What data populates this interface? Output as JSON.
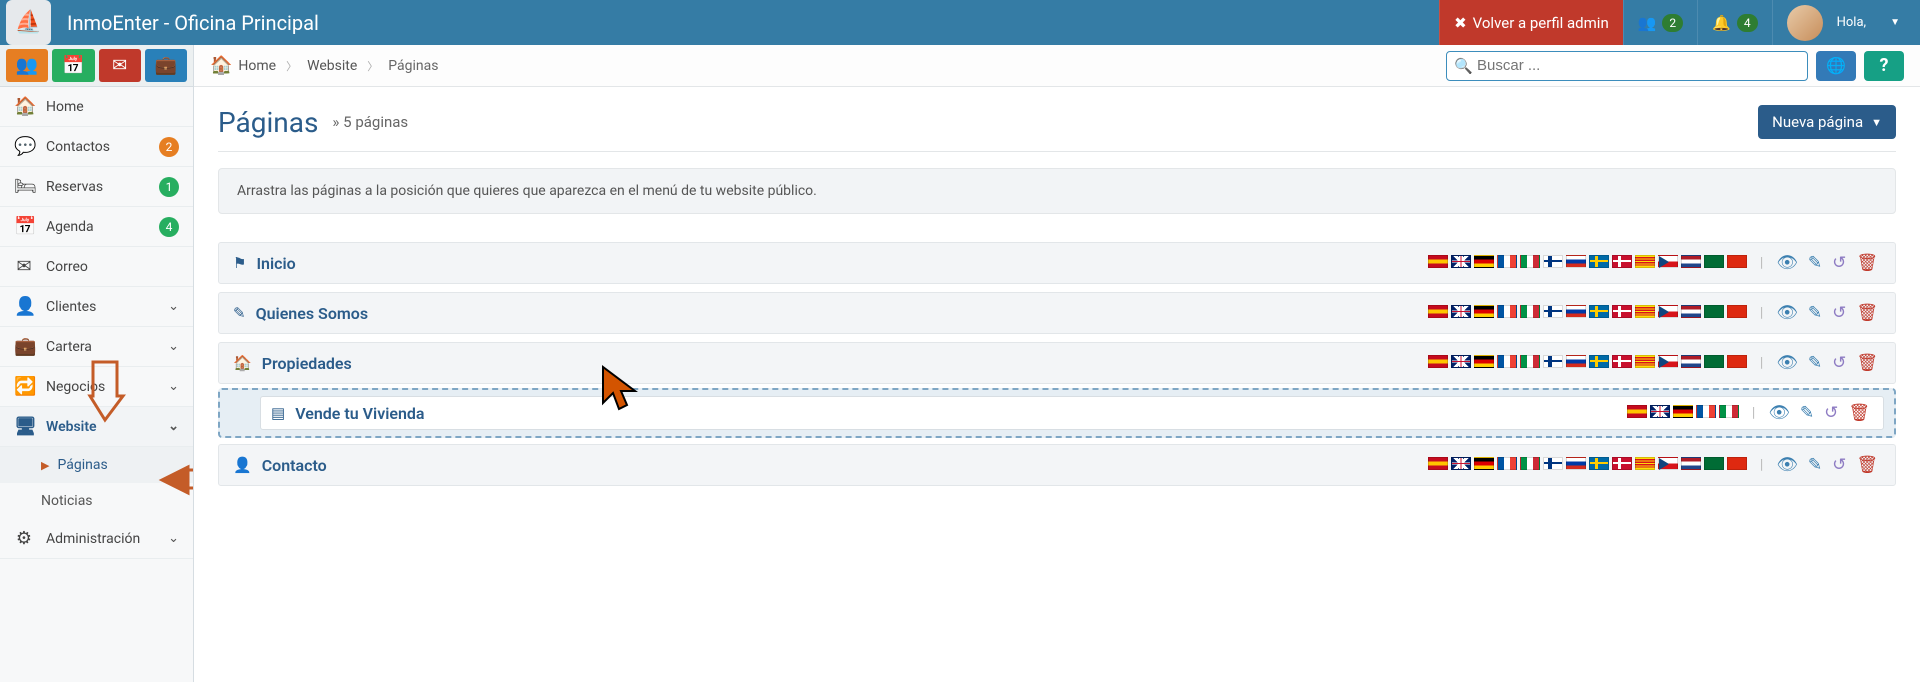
{
  "header": {
    "title": "InmoEnter - Oficina Principal",
    "back_admin": "Volver a perfil admin",
    "greeting": "Hola,",
    "notif_users_badge": "2",
    "notif_bell_badge": "4"
  },
  "breadcrumb": {
    "home": "Home",
    "website": "Website",
    "paginas": "Páginas"
  },
  "search": {
    "placeholder": "Buscar ..."
  },
  "actions": {
    "help": "?"
  },
  "sidebar": {
    "items": [
      {
        "icon": "home",
        "label": "Home"
      },
      {
        "icon": "chat",
        "label": "Contactos",
        "badge": "2",
        "badgeClass": "sb-orange"
      },
      {
        "icon": "bed",
        "label": "Reservas",
        "badge": "1",
        "badgeClass": "sb-green"
      },
      {
        "icon": "calendar",
        "label": "Agenda",
        "badge": "4",
        "badgeClass": "sb-green"
      },
      {
        "icon": "mail",
        "label": "Correo"
      },
      {
        "icon": "user",
        "label": "Clientes",
        "chev": true
      },
      {
        "icon": "briefcase",
        "label": "Cartera",
        "chev": true
      },
      {
        "icon": "refresh",
        "label": "Negocios",
        "chev": true
      },
      {
        "icon": "monitor",
        "label": "Website",
        "chev": true,
        "active": true
      },
      {
        "icon": "sliders",
        "label": "Administración",
        "chev": true
      }
    ],
    "subs": [
      {
        "label": "Páginas",
        "active": true
      },
      {
        "label": "Noticias"
      }
    ]
  },
  "page": {
    "title": "Páginas",
    "subtitle": "» 5 páginas",
    "new_btn": "Nueva página",
    "info": "Arrastra las páginas a la posición que quieres que aparezca en el menú de tu website público."
  },
  "rows": [
    {
      "icon": "flag",
      "label": "Inicio"
    },
    {
      "icon": "edit",
      "label": "Quienes Somos"
    },
    {
      "icon": "home",
      "label": "Propiedades"
    },
    {
      "icon": "form",
      "label": "Vende tu Vivienda"
    },
    {
      "icon": "user",
      "label": "Contacto"
    }
  ],
  "flag_set_full": [
    "es",
    "gb",
    "de",
    "fr",
    "it",
    "fi",
    "ru",
    "se",
    "dk",
    "ca",
    "cz",
    "nl",
    "sa",
    "cn"
  ],
  "flag_set_small": [
    "es",
    "gb",
    "de",
    "fr",
    "it"
  ]
}
